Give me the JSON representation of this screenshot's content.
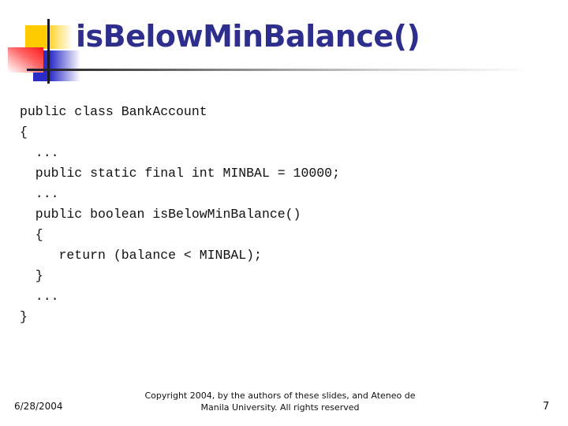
{
  "slide": {
    "title": "isBelowMinBalance()",
    "code_lines": [
      "public class BankAccount",
      "{",
      "  ...",
      "  public static final int MINBAL = 10000;",
      "  ...",
      "  public boolean isBelowMinBalance()",
      "  {",
      "     return (balance < MINBAL);",
      "  }",
      "  ...",
      "}"
    ],
    "footer": {
      "date": "6/28/2004",
      "copyright_line1": "Copyright 2004, by the authors of these slides, and Ateneo de",
      "copyright_line2": "Manila University. All rights reserved",
      "page_number": "7"
    }
  },
  "colors": {
    "title": "#2e2e8c",
    "logo_yellow": "#ffcc00",
    "logo_red": "#ff1a1a",
    "logo_blue": "#2b2bc8"
  }
}
